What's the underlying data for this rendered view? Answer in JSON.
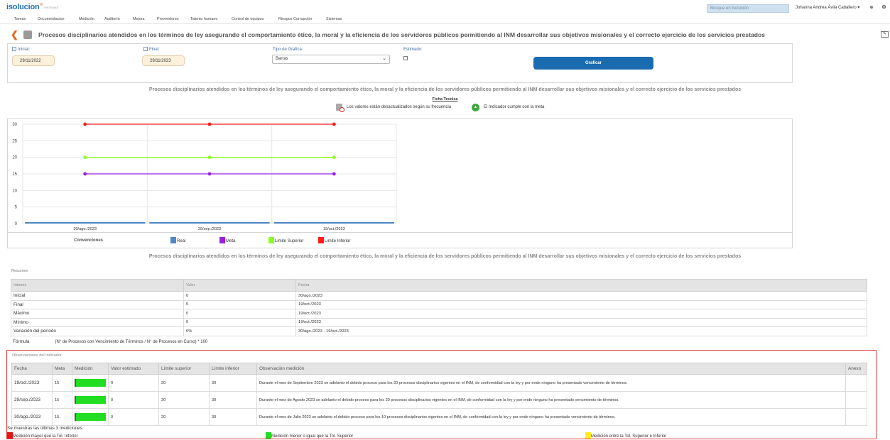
{
  "app": {
    "logo": "isolucion",
    "logo_sup": "®",
    "logo_sub": "SISTEMAS",
    "search_placeholder": "Busque en Isolución",
    "user_name": "Johanna Andrea Ávila Caballero",
    "user_caret": "▾"
  },
  "nav": [
    "Tareas",
    "Documentacion",
    "Medición",
    "Auditoría",
    "Mejora",
    "Proveedores",
    "Talento humano",
    "Control de equipos",
    "Riesgos Corrupción",
    "Sistemas"
  ],
  "page_title": "Procesos disciplinarios atendidos en los términos de ley asegurando el comportamiento ético, la moral y la eficiencia de los servidores públicos permitiendo al INM desarrollar sus objetivos misionales y el correcto ejercicio de los servicios prestados",
  "filters": {
    "inicial_label": "Inicial:",
    "inicial_value": "29/11/2022",
    "final_label": "Final:",
    "final_value": "29/11/2023",
    "tipo_label": "Tipo de Grafica:",
    "tipo_value": "Barras",
    "estimado_label": "Estimado:",
    "graficar_label": "Graficar"
  },
  "ficha_tecnica": "Ficha Tecnica",
  "status": {
    "desactualizado": "Los valores están desactualizados según su frecuencia",
    "cumple": "El Indicador cumple con la meta",
    "cumple_icon": "▲"
  },
  "colors": {
    "real": "#4f86c6",
    "meta": "#9b1fe0",
    "limite_superior": "#88ff22",
    "limite_inferior": "#ff1a1a"
  },
  "chart_data": {
    "type": "line",
    "categories": [
      "30/ago./2023",
      "29/sep./2023",
      "19/oct./2023"
    ],
    "series": [
      {
        "name": "Real",
        "values": [
          0,
          0,
          0
        ]
      },
      {
        "name": "Meta",
        "values": [
          15,
          15,
          15
        ]
      },
      {
        "name": "Limite Superior",
        "values": [
          20,
          20,
          20
        ]
      },
      {
        "name": "Limite Inferior",
        "values": [
          30,
          30,
          30
        ]
      }
    ],
    "ylim": [
      0,
      30
    ],
    "yticks": [
      0,
      5,
      10,
      15,
      20,
      25,
      30
    ],
    "grid": true,
    "legend_placement": "bottom"
  },
  "legend": {
    "title": "Convenciones",
    "items": [
      "Real",
      "Meta",
      "Limite Superior",
      "Limite Inferior"
    ]
  },
  "resumen": {
    "title": "Resumen",
    "headers": [
      "Valores",
      "Valor",
      "Fecha"
    ],
    "rows": [
      [
        "Inicial",
        "0",
        "30/ago./2023"
      ],
      [
        "Final",
        "0",
        "19/oct./2023"
      ],
      [
        "Máximo",
        "0",
        "19/oct./2023"
      ],
      [
        "Mínimo",
        "0",
        "19/oct./2023"
      ],
      [
        "Variación del período",
        "0%",
        "30/ago./2023 - 19/oct./2023"
      ]
    ],
    "formula_label": "Fórmula",
    "formula_value": "(N° de Procesos con Vencimiento de Términos / N° de Procesos en Curso) * 100"
  },
  "observaciones": {
    "title": "Observaciones del Indicador",
    "headers": [
      "Fecha",
      "Meta",
      "Medición",
      "Valor estimado",
      "Límite superior",
      "Límite inferior",
      "Observación medición",
      "Anexo"
    ],
    "rows": [
      {
        "fecha": "19/oct./2023",
        "meta": "15",
        "medicion_fill": 1.0,
        "valor_estimado": "0",
        "lim_sup": "20",
        "lim_inf": "30",
        "obs": "Durante el mes de Septiembre 2023 se adelanto el debido proceso para los 20 procesos disciplinarios vigentes en el INM, de conformidad con la ley y por ende ninguno ha presentado vencimiento de términos.",
        "anexo": ""
      },
      {
        "fecha": "29/sep./2023",
        "meta": "15",
        "medicion_fill": 1.0,
        "valor_estimado": "0",
        "lim_sup": "20",
        "lim_inf": "30",
        "obs": "Durante el mes de Agosto 2023 se adelanto el debido proceso para los 20 procesos disciplinarios vigentes en el INM, de conformidad con la ley y por ende ninguno ha presentado vencimiento de términos.",
        "anexo": ""
      },
      {
        "fecha": "30/ago./2023",
        "meta": "15",
        "medicion_fill": 1.0,
        "valor_estimado": "0",
        "lim_sup": "20",
        "lim_inf": "30",
        "obs": "Durante el mes de Julio 2023 se adelanto el debido proceso para los 10 procesos disciplinarios vigentes en el INM, de conformidad con la ley y por ende ninguno ha presentado vencimiento de términos.",
        "anexo": ""
      }
    ],
    "footer": "Se muestras las últimas 3 mediciones",
    "legend": [
      {
        "label": "Medición mayor que la Tol. Inferior",
        "color": "#e01515"
      },
      {
        "label": "Medición menor o igual que la Tol. Superior",
        "color": "#22dd22"
      },
      {
        "label": "Medición entre la Tol. Superior e Inferior",
        "color": "#ffee22"
      }
    ]
  }
}
